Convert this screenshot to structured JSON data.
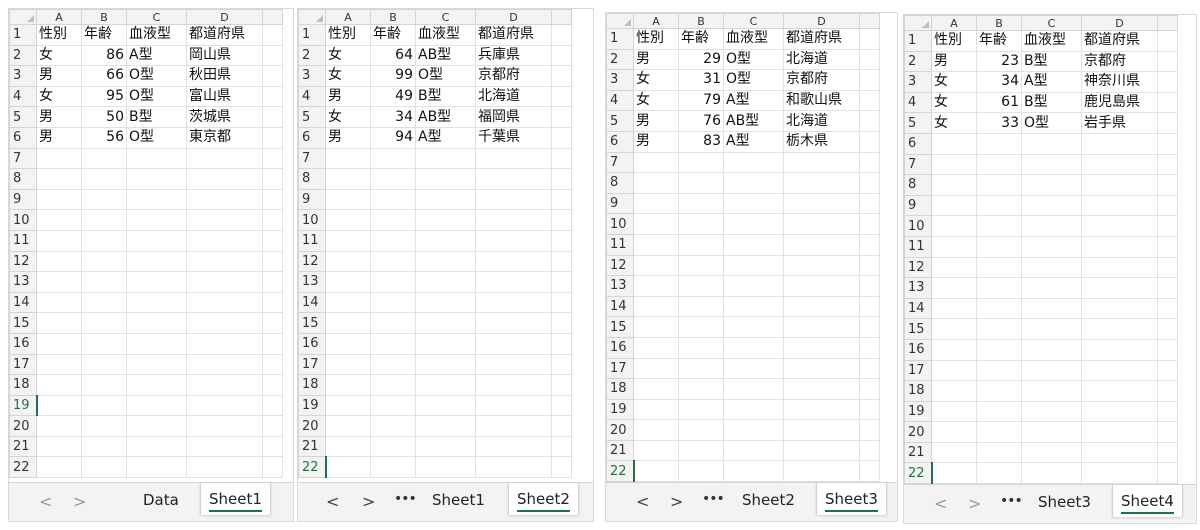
{
  "column_headers": [
    "A",
    "B",
    "C",
    "D"
  ],
  "row_numbers": [
    "1",
    "2",
    "3",
    "4",
    "5",
    "6",
    "7",
    "8",
    "9",
    "10",
    "11",
    "12",
    "13",
    "14",
    "15",
    "16",
    "17",
    "18",
    "19",
    "20",
    "21",
    "22"
  ],
  "accent_color": "#1e7145",
  "panels": [
    {
      "rows": [
        [
          "性別",
          "年齢",
          "血液型",
          "都道府県"
        ],
        [
          "女",
          "86",
          "A型",
          "岡山県"
        ],
        [
          "男",
          "66",
          "O型",
          "秋田県"
        ],
        [
          "女",
          "95",
          "O型",
          "富山県"
        ],
        [
          "男",
          "50",
          "B型",
          "茨城県"
        ],
        [
          "男",
          "56",
          "O型",
          "東京都"
        ]
      ],
      "tabs": {
        "prev": "<",
        "next": ">",
        "more": "",
        "inactive": "Data",
        "active": "Sheet1"
      }
    },
    {
      "rows": [
        [
          "性別",
          "年齢",
          "血液型",
          "都道府県"
        ],
        [
          "女",
          "64",
          "AB型",
          "兵庫県"
        ],
        [
          "女",
          "99",
          "O型",
          "京都府"
        ],
        [
          "男",
          "49",
          "B型",
          "北海道"
        ],
        [
          "女",
          "34",
          "AB型",
          "福岡県"
        ],
        [
          "男",
          "94",
          "A型",
          "千葉県"
        ]
      ],
      "tabs": {
        "prev": "<",
        "next": ">",
        "more": "•••",
        "inactive": "Sheet1",
        "active": "Sheet2"
      }
    },
    {
      "rows": [
        [
          "性別",
          "年齢",
          "血液型",
          "都道府県"
        ],
        [
          "男",
          "29",
          "O型",
          "北海道"
        ],
        [
          "女",
          "31",
          "O型",
          "京都府"
        ],
        [
          "女",
          "79",
          "A型",
          "和歌山県"
        ],
        [
          "男",
          "76",
          "AB型",
          "北海道"
        ],
        [
          "男",
          "83",
          "A型",
          "栃木県"
        ]
      ],
      "tabs": {
        "prev": "<",
        "next": ">",
        "more": "•••",
        "inactive": "Sheet2",
        "active": "Sheet3"
      }
    },
    {
      "rows": [
        [
          "性別",
          "年齢",
          "血液型",
          "都道府県"
        ],
        [
          "男",
          "23",
          "B型",
          "京都府"
        ],
        [
          "女",
          "34",
          "A型",
          "神奈川県"
        ],
        [
          "女",
          "61",
          "B型",
          "鹿児島県"
        ],
        [
          "女",
          "33",
          "O型",
          "岩手県"
        ]
      ],
      "tabs": {
        "prev": "<",
        "next": ">",
        "more": "•••",
        "inactive": "Sheet3",
        "active": "Sheet4"
      }
    }
  ]
}
